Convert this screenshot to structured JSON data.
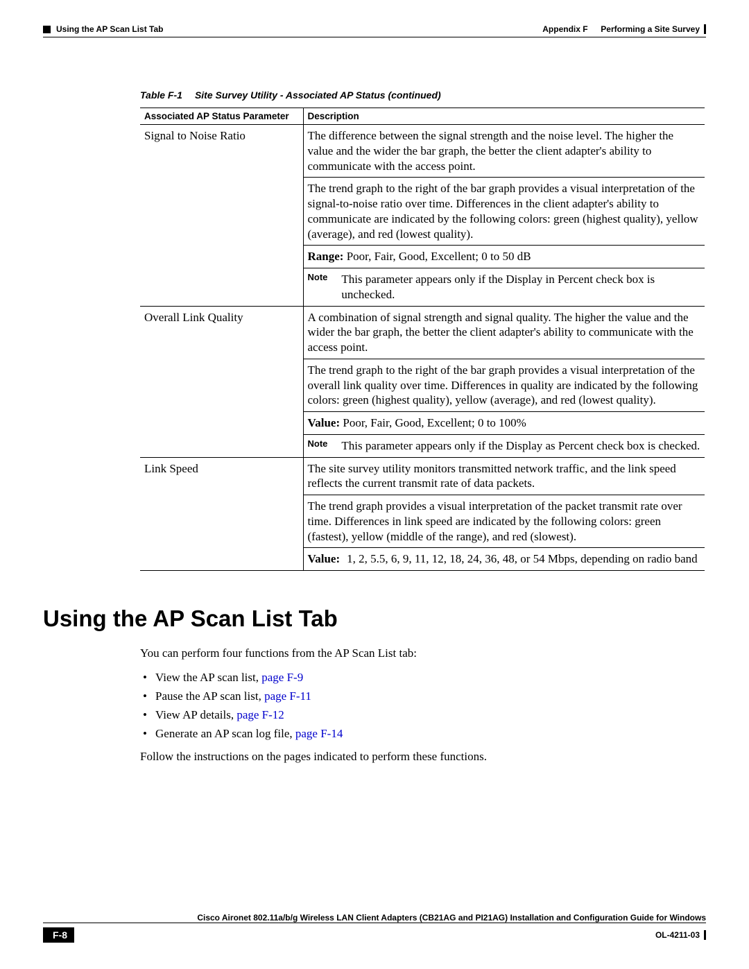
{
  "header": {
    "section_left": "Using the AP Scan List Tab",
    "appendix_label": "Appendix F",
    "appendix_title": "Performing a Site Survey"
  },
  "table": {
    "caption_label": "Table F-1",
    "caption_title": "Site Survey Utility - Associated AP Status (continued)",
    "col1": "Associated AP Status Parameter",
    "col2": "Description",
    "rows": {
      "snr": {
        "param": "Signal to Noise Ratio",
        "p1": "The difference between the signal strength and the noise level. The higher the value and the wider the bar graph, the better the client adapter's ability to communicate with the access point.",
        "p2": "The trend graph to the right of the bar graph provides a visual interpretation of the signal-to-noise ratio over time. Differences in the client adapter's ability to communicate are indicated by the following colors: green (highest quality), yellow (average), and red (lowest quality).",
        "range_label": "Range:",
        "range_value": "Poor, Fair, Good, Excellent; 0 to 50 dB",
        "note_label": "Note",
        "note_text": "This parameter appears only if the Display in Percent check box is unchecked."
      },
      "olq": {
        "param": "Overall Link Quality",
        "p1": "A combination of signal strength and signal quality. The higher the value and the wider the bar graph, the better the client adapter's ability to communicate with the access point.",
        "p2": "The trend graph to the right of the bar graph provides a visual interpretation of the overall link quality over time. Differences in quality are indicated by the following colors: green (highest quality), yellow (average), and red (lowest quality).",
        "value_label": "Value:",
        "value_value": "Poor, Fair, Good, Excellent; 0 to 100%",
        "note_label": "Note",
        "note_text": "This parameter appears only if the Display as Percent check box is checked."
      },
      "ls": {
        "param": "Link Speed",
        "p1": "The site survey utility monitors transmitted network traffic, and the link speed reflects the current transmit rate of data packets.",
        "p2": "The trend graph provides a visual interpretation of the packet transmit rate over time. Differences in link speed are indicated by the following colors: green (fastest), yellow (middle of the range), and red (slowest).",
        "value_label": "Value:",
        "value_value": "1, 2, 5.5, 6, 9, 11, 12, 18, 24, 36, 48, or 54 Mbps, depending on radio band"
      }
    }
  },
  "section": {
    "heading": "Using the AP Scan List Tab",
    "intro": "You can perform four functions from the AP Scan List tab:",
    "bullets": [
      {
        "text": "View the AP scan list, ",
        "link": "page F-9"
      },
      {
        "text": "Pause the AP scan list, ",
        "link": "page F-11"
      },
      {
        "text": "View AP details, ",
        "link": "page F-12"
      },
      {
        "text": "Generate an AP scan log file, ",
        "link": "page F-14"
      }
    ],
    "follow": "Follow the instructions on the pages indicated to perform these functions."
  },
  "footer": {
    "book_title": "Cisco Aironet 802.11a/b/g Wireless LAN Client Adapters (CB21AG and PI21AG) Installation and Configuration Guide for Windows",
    "page_number": "F-8",
    "doc_id": "OL-4211-03"
  }
}
